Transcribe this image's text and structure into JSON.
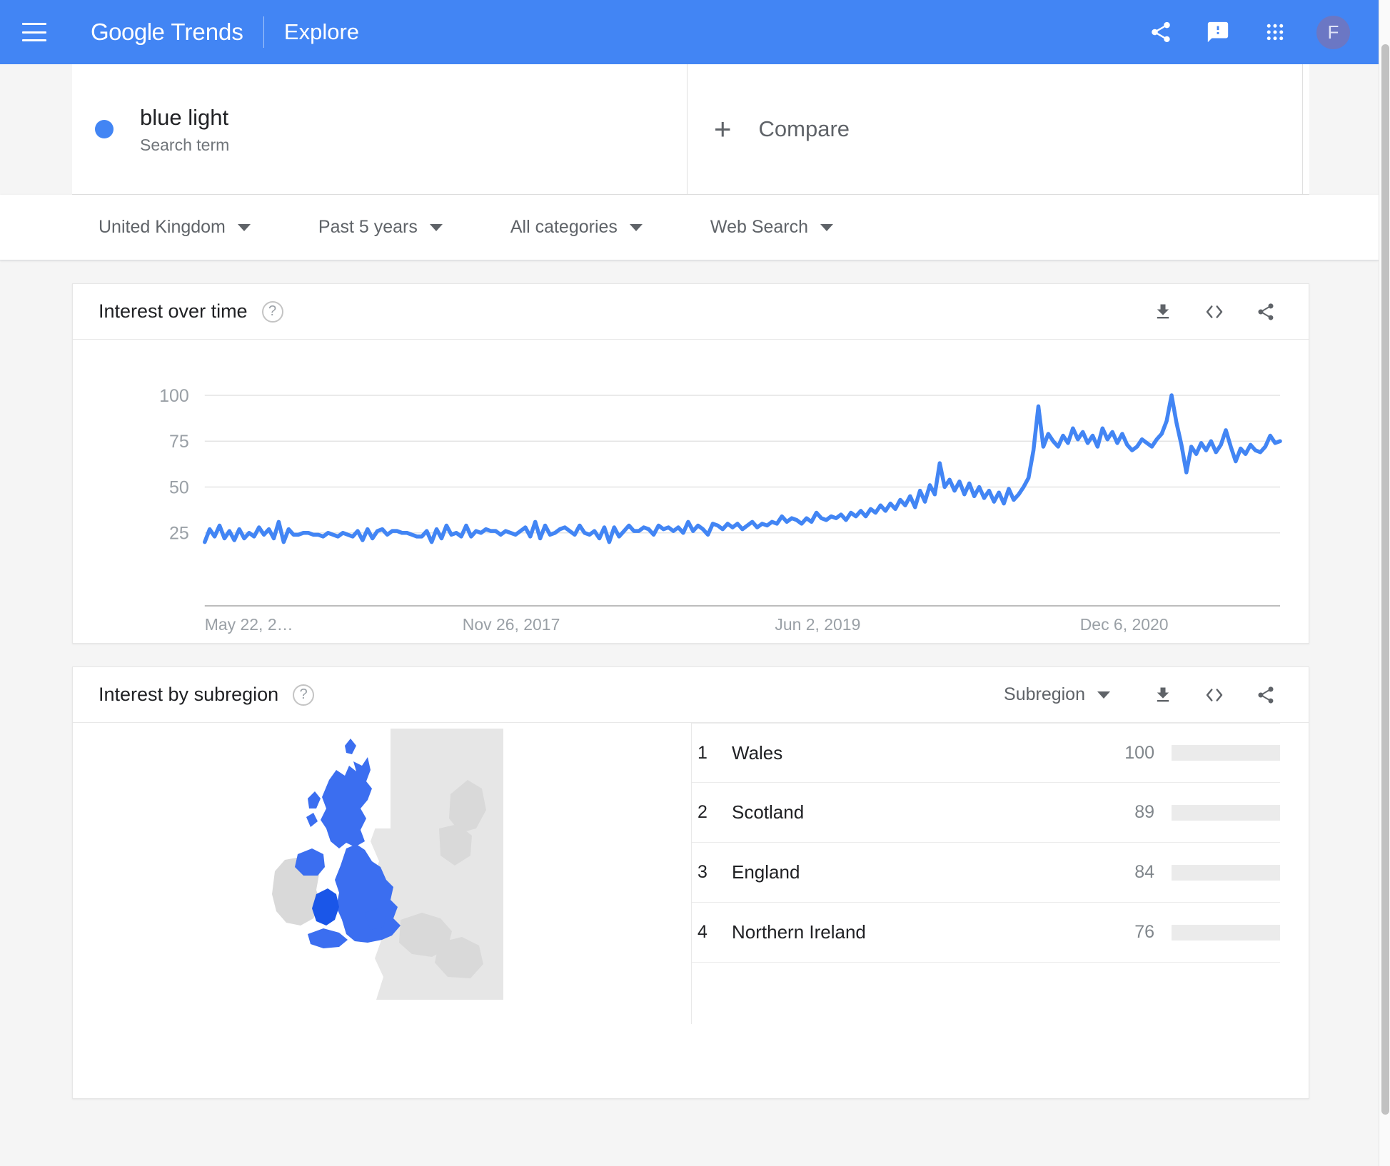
{
  "header": {
    "menu_icon": "hamburger-menu-icon",
    "brand_google": "Google",
    "brand_trends": "Trends",
    "explore_label": "Explore",
    "share_icon": "share-icon",
    "feedback_icon": "feedback-icon",
    "apps_icon": "apps-grid-icon",
    "avatar_initial": "F",
    "background_color": "#4285f4"
  },
  "search": {
    "term": "blue light",
    "term_type": "Search term",
    "dot_color": "#4285f4",
    "compare_label": "Compare",
    "compare_icon": "plus-icon"
  },
  "filters": [
    {
      "label": "United Kingdom",
      "name": "location-filter"
    },
    {
      "label": "Past 5 years",
      "name": "time-range-filter"
    },
    {
      "label": "All categories",
      "name": "category-filter"
    },
    {
      "label": "Web Search",
      "name": "search-type-filter"
    }
  ],
  "interest_over_time": {
    "title": "Interest over time",
    "help_icon": "help-icon",
    "download_icon": "download-icon",
    "embed_icon": "embed-code-icon",
    "share_icon": "share-icon"
  },
  "interest_by_subregion": {
    "title": "Interest by subregion",
    "help_icon": "help-icon",
    "selector_label": "Subregion",
    "download_icon": "download-icon",
    "embed_icon": "embed-code-icon",
    "share_icon": "share-icon",
    "map_highlight_color": "#3b6ef0",
    "map_base_color": "#e0e0e0",
    "rows": [
      {
        "rank": "1",
        "name": "Wales",
        "value": "100",
        "pct": 100
      },
      {
        "rank": "2",
        "name": "Scotland",
        "value": "89",
        "pct": 89
      },
      {
        "rank": "3",
        "name": "England",
        "value": "84",
        "pct": 84
      },
      {
        "rank": "4",
        "name": "Northern Ireland",
        "value": "76",
        "pct": 76
      }
    ]
  },
  "chart_data": {
    "type": "line",
    "title": "Interest over time",
    "xlabel": "",
    "ylabel": "",
    "ylim": [
      0,
      100
    ],
    "yticks": [
      25,
      50,
      75,
      100
    ],
    "ytick_labels": [
      "25",
      "50",
      "75",
      "100"
    ],
    "xtick_labels": [
      "May 22, 2…",
      "Nov 26, 2017",
      "Jun 2, 2019",
      "Dec 6, 2020"
    ],
    "xtick_positions": [
      0,
      0.285,
      0.57,
      0.855
    ],
    "grid": true,
    "legend": "none",
    "series": [
      {
        "name": "blue light",
        "color": "#4285f4",
        "values": [
          20,
          27,
          23,
          29,
          22,
          26,
          21,
          27,
          22,
          25,
          23,
          28,
          24,
          27,
          22,
          31,
          20,
          27,
          24,
          24,
          25,
          25,
          24,
          24,
          23,
          25,
          24,
          23,
          25,
          24,
          23,
          26,
          21,
          27,
          22,
          26,
          27,
          24,
          26,
          26,
          25,
          25,
          24,
          23,
          23,
          26,
          20,
          27,
          22,
          29,
          24,
          25,
          23,
          29,
          23,
          26,
          25,
          27,
          26,
          26,
          24,
          26,
          25,
          24,
          26,
          28,
          23,
          31,
          22,
          29,
          24,
          25,
          27,
          28,
          26,
          24,
          29,
          25,
          24,
          26,
          22,
          28,
          20,
          28,
          23,
          26,
          29,
          26,
          26,
          28,
          27,
          24,
          29,
          27,
          28,
          26,
          28,
          25,
          31,
          26,
          29,
          27,
          24,
          30,
          29,
          27,
          30,
          28,
          30,
          27,
          29,
          31,
          28,
          30,
          29,
          31,
          30,
          34,
          31,
          33,
          32,
          30,
          33,
          31,
          36,
          33,
          32,
          34,
          33,
          35,
          32,
          36,
          34,
          37,
          34,
          38,
          36,
          40,
          37,
          41,
          38,
          43,
          40,
          45,
          39,
          48,
          42,
          51,
          46,
          63,
          50,
          54,
          48,
          53,
          46,
          52,
          45,
          50,
          44,
          48,
          42,
          47,
          41,
          49,
          43,
          46,
          50,
          55,
          70,
          94,
          72,
          79,
          75,
          72,
          78,
          74,
          82,
          76,
          80,
          74,
          78,
          72,
          82,
          76,
          80,
          74,
          79,
          73,
          70,
          72,
          76,
          74,
          72,
          76,
          79,
          86,
          100,
          85,
          73,
          58,
          72,
          68,
          74,
          70,
          75,
          69,
          73,
          81,
          72,
          64,
          71,
          68,
          73,
          70,
          69,
          72,
          78,
          74,
          75
        ]
      }
    ]
  }
}
